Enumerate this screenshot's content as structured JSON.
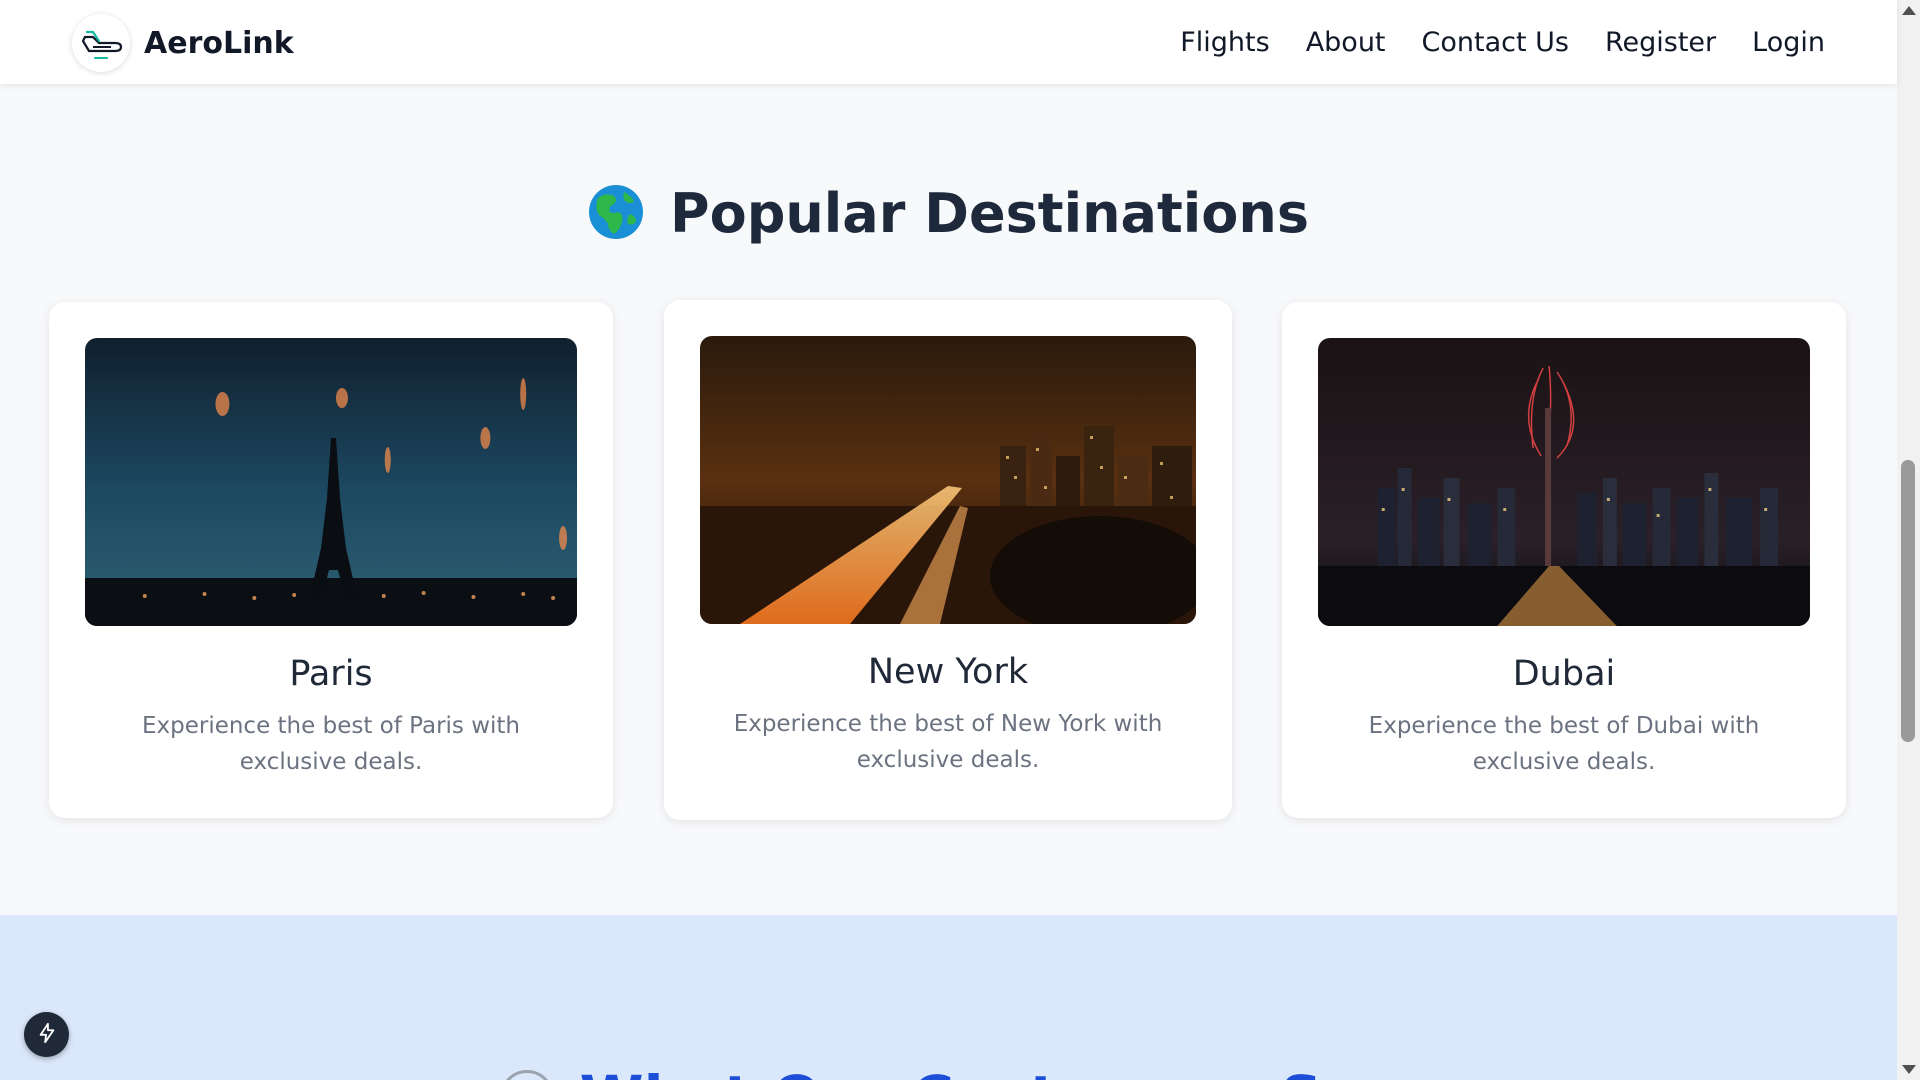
{
  "navbar": {
    "brand": "AeroLink",
    "logo_icon": "airplane-logo-icon",
    "links": [
      "Flights",
      "About",
      "Contact Us",
      "Register",
      "Login"
    ]
  },
  "destinations": {
    "heading": "Popular Destinations",
    "heading_icon": "globe-icon",
    "cards": [
      {
        "title": "Paris",
        "description": "Experience the best of Paris with exclusive deals.",
        "image": "paris-eiffel-tower-night-photo"
      },
      {
        "title": "New York",
        "description": "Experience the best of New York with exclusive deals.",
        "image": "new-york-city-night-traffic-photo"
      },
      {
        "title": "Dubai",
        "description": "Experience the best of Dubai with exclusive deals.",
        "image": "dubai-skyline-fireworks-photo"
      }
    ]
  },
  "testimonials": {
    "heading": "What Our Customers Say",
    "heading_icon": "chat-icon"
  },
  "floating_button": {
    "icon": "lightning-icon"
  },
  "colors": {
    "page_bg": "#f8f9fb",
    "heading": "#1e293b",
    "testimonials_bg": "#dbe8fb",
    "testimonials_heading": "#1d4ed8"
  }
}
